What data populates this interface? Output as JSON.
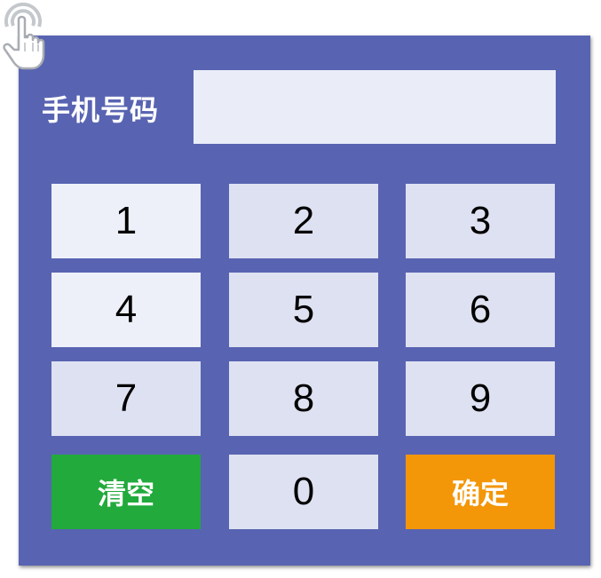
{
  "icons": {
    "cursor": "hand-pointer-icon"
  },
  "colors": {
    "panel": "#5864b2",
    "input": "#eaedf8",
    "key_light": "#edf0f9",
    "key_mid": "#dee1f1",
    "clear": "#22aa3c",
    "confirm": "#f39607"
  },
  "form": {
    "phone_label": "手机号码",
    "phone_value": ""
  },
  "keypad": {
    "keys": [
      "1",
      "2",
      "3",
      "4",
      "5",
      "6",
      "7",
      "8",
      "9"
    ],
    "zero": "0",
    "clear_label": "清空",
    "confirm_label": "确定"
  }
}
